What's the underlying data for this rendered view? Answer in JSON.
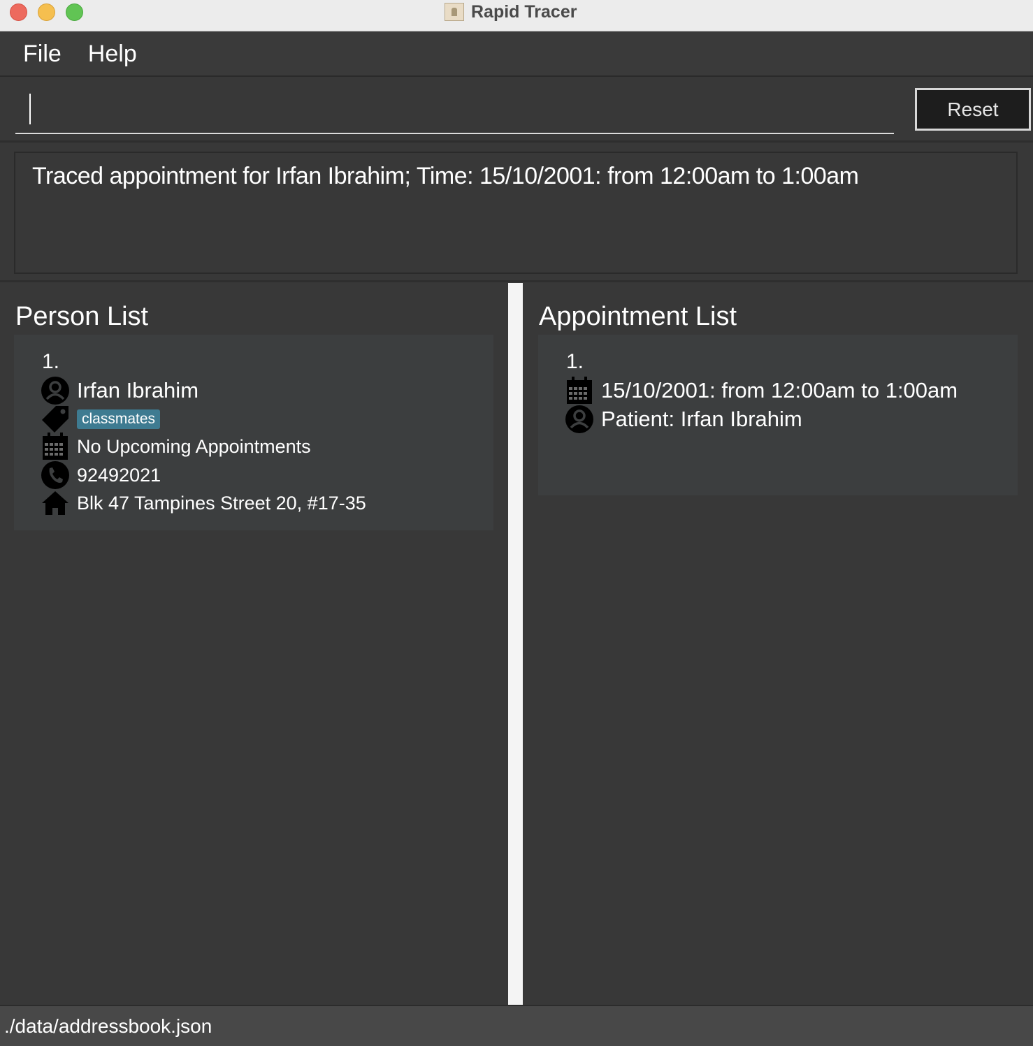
{
  "window": {
    "title": "Rapid Tracer",
    "app_icon": "address-book-icon"
  },
  "menu": {
    "file": "File",
    "help": "Help"
  },
  "command": {
    "value": "",
    "reset_label": "Reset"
  },
  "result": {
    "text": "Traced appointment for Irfan Ibrahim; Time: 15/10/2001: from 12:00am to 1:00am"
  },
  "person_list": {
    "title": "Person List",
    "items": [
      {
        "index": "1.",
        "name": "Irfan Ibrahim",
        "tags": [
          "classmates"
        ],
        "appointments": "No Upcoming Appointments",
        "phone": "92492021",
        "address": "Blk 47 Tampines Street 20, #17-35"
      }
    ]
  },
  "appointment_list": {
    "title": "Appointment List",
    "items": [
      {
        "index": "1.",
        "time": "15/10/2001: from 12:00am to 1:00am",
        "patient": "Patient: Irfan Ibrahim"
      }
    ]
  },
  "status": {
    "path": "./data/addressbook.json"
  },
  "colors": {
    "background": "#383838",
    "card": "#3c3e3f",
    "tag": "#3e7b91",
    "splitter": "#f4f4f4"
  }
}
